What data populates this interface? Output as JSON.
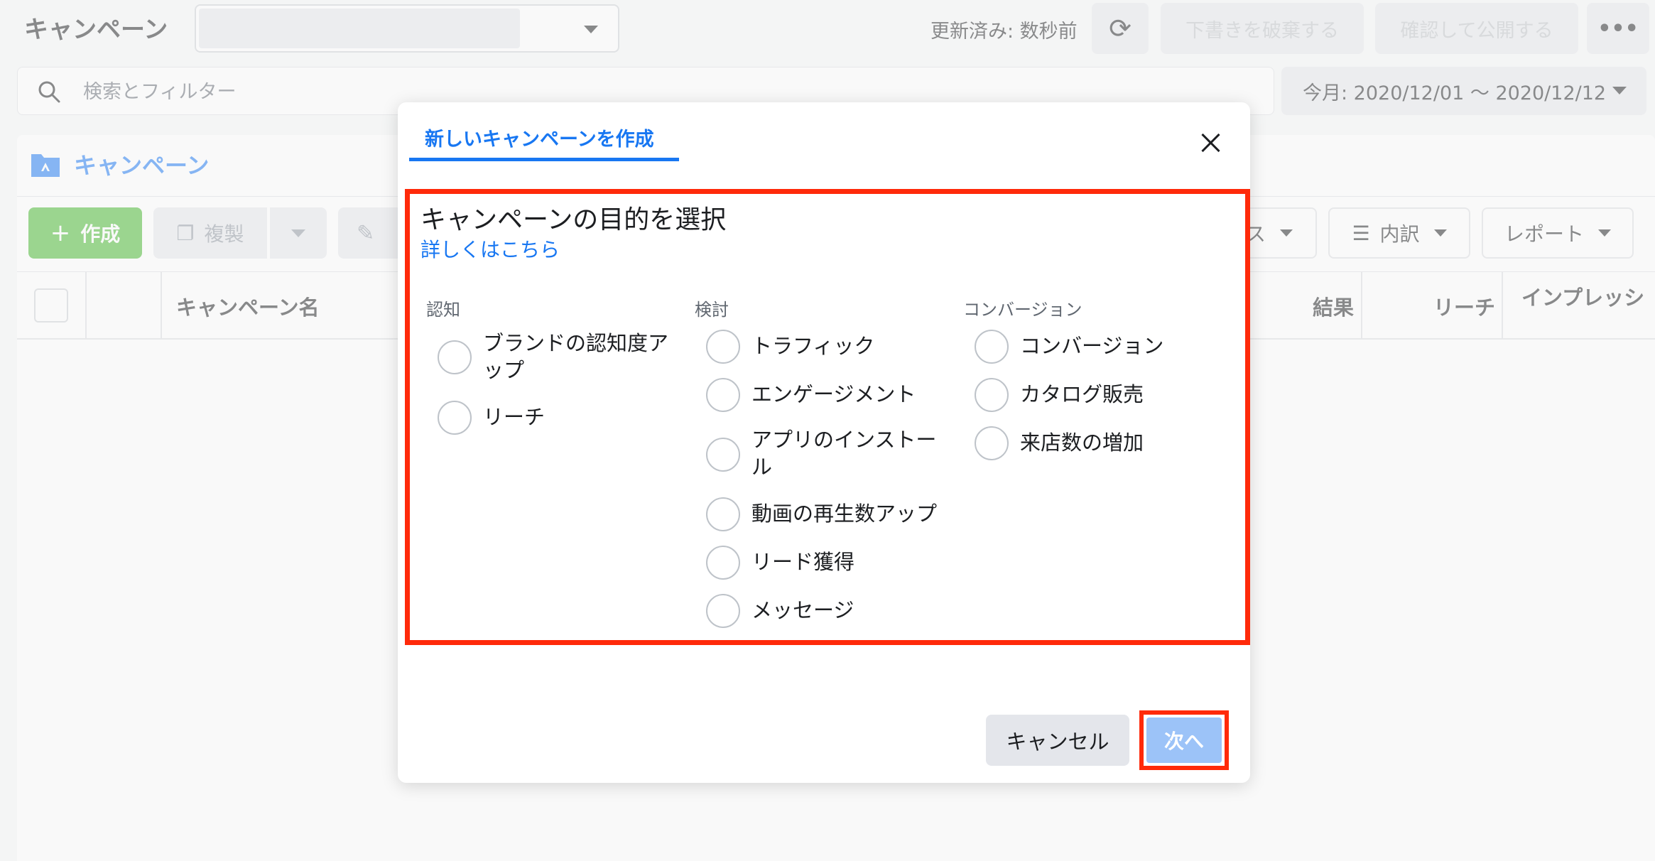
{
  "app": {
    "title": "キャンペーン",
    "updated_status": "更新済み: 数秒前",
    "discard_draft": "下書きを破棄する",
    "review_publish": "確認して公開する",
    "more": "•••"
  },
  "search": {
    "placeholder": "検索とフィルター"
  },
  "date_range": {
    "value": "今月: 2020/12/01 〜 2020/12/12"
  },
  "tabs": {
    "campaign": "キャンペーン"
  },
  "toolbar": {
    "create": "作成",
    "duplicate": "複製",
    "breakdown": "内訳",
    "reports": "レポート",
    "partial_label": "ス"
  },
  "table": {
    "columns": [
      "キャンペーン名",
      "結果",
      "リーチ",
      "インプレッシ"
    ]
  },
  "modal": {
    "tab_label": "新しいキャンペーンを作成",
    "heading": "キャンペーンの目的を選択",
    "learn_more": "詳しくはこちら",
    "columns": [
      {
        "header": "認知",
        "options": [
          "ブランドの認知度アップ",
          "リーチ"
        ]
      },
      {
        "header": "検討",
        "options": [
          "トラフィック",
          "エンゲージメント",
          "アプリのインストール",
          "動画の再生数アップ",
          "リード獲得",
          "メッセージ"
        ]
      },
      {
        "header": "コンバージョン",
        "options": [
          "コンバージョン",
          "カタログ販売",
          "来店数の増加"
        ]
      }
    ],
    "cancel": "キャンセル",
    "next": "次へ"
  },
  "colors": {
    "accent": "#1877f2",
    "create_green": "#42b72a",
    "highlight_red": "#ff2a0a",
    "next_disabled": "#9cc3f8"
  }
}
